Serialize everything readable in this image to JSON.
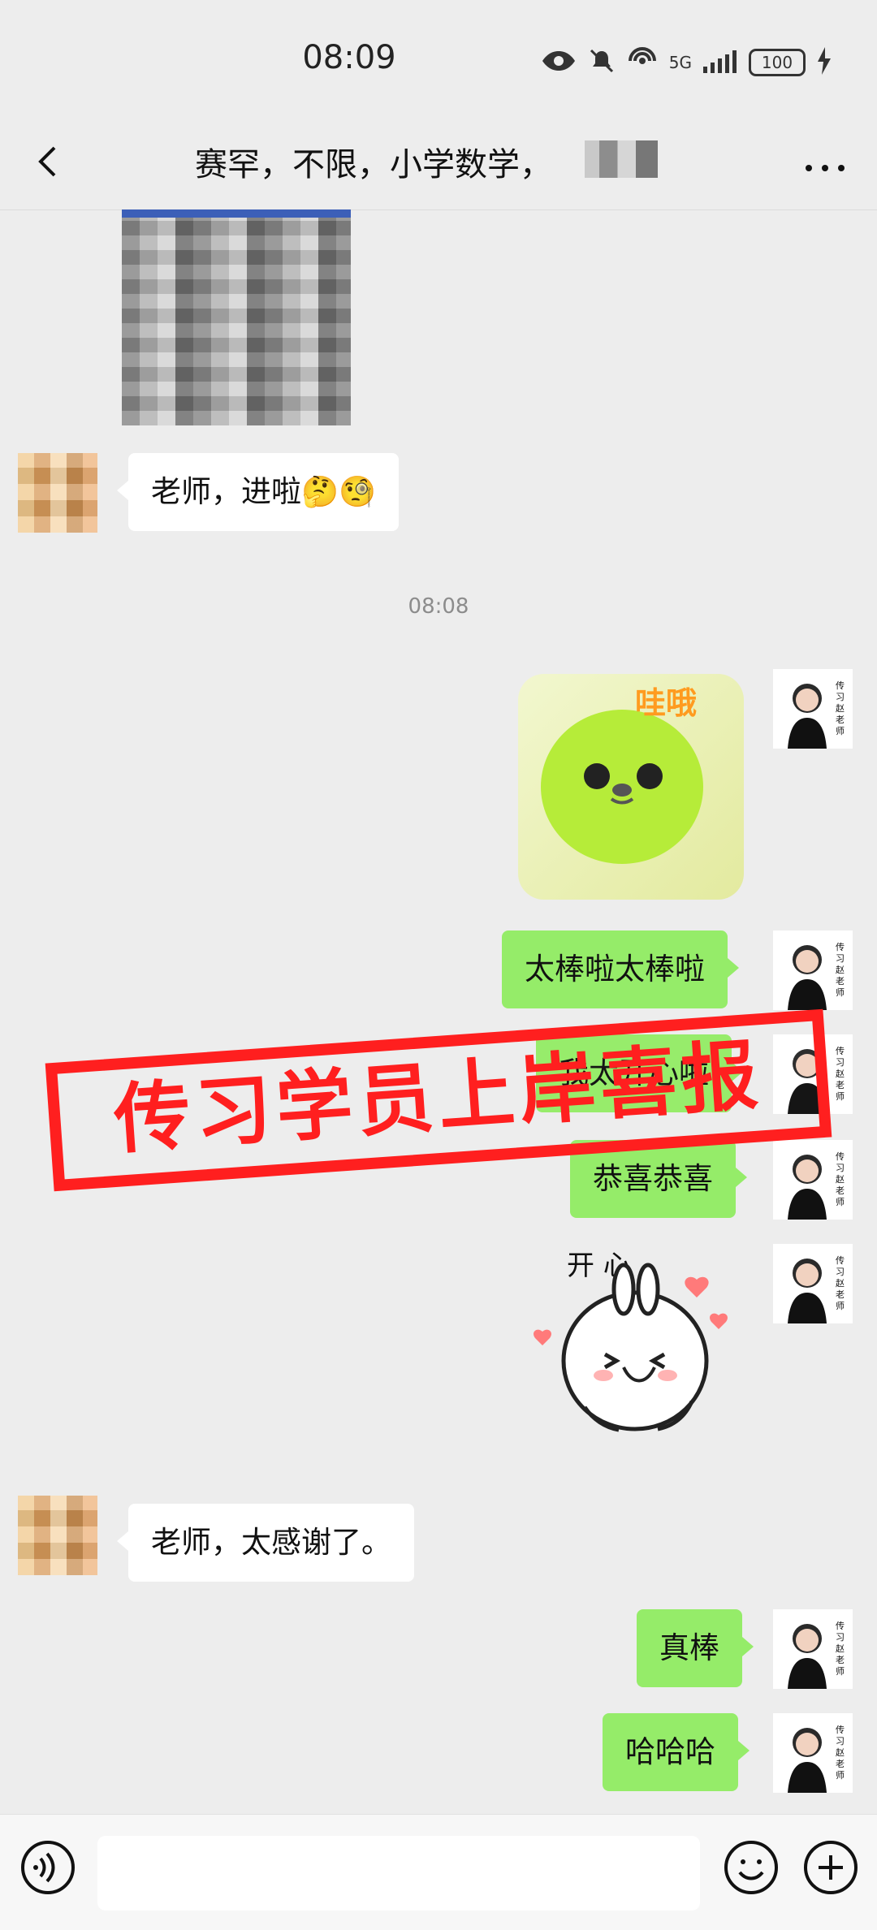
{
  "status": {
    "time": "08:09",
    "battery": "100",
    "network": "5G"
  },
  "header": {
    "title": "赛罕，不限，小学数学，"
  },
  "chat": {
    "time_divider": "08:08",
    "messages": [
      {
        "side": "left",
        "text": "老师，进啦🤔🧐"
      },
      {
        "side": "right",
        "text": "太棒啦太棒啦"
      },
      {
        "side": "right",
        "text": "我太开心啦"
      },
      {
        "side": "right",
        "text": "恭喜恭喜"
      },
      {
        "side": "left",
        "text": "老师，太感谢了。"
      },
      {
        "side": "right",
        "text": "真棒"
      },
      {
        "side": "right",
        "text": "哈哈哈"
      }
    ],
    "stamp_text": "传习学员上岸喜报",
    "sticker_top_text": "哇哦",
    "sticker_kaixin_text": "开   心",
    "avatar_text": "传习赵老师"
  },
  "colors": {
    "background": "#ededed",
    "my_bubble": "#95ec69",
    "friend_bubble": "#ffffff",
    "stamp": "#ff1f1f"
  }
}
